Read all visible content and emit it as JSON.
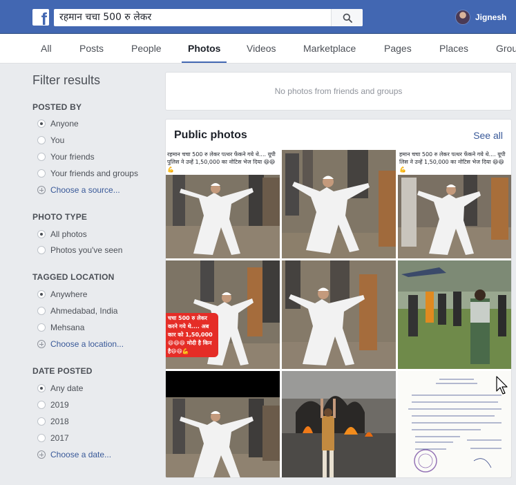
{
  "header": {
    "search_value": "रहमान चचा 500 रु लेकर",
    "user_name": "Jignesh",
    "brand_color": "#4267b2"
  },
  "tabs": [
    {
      "label": "All"
    },
    {
      "label": "Posts"
    },
    {
      "label": "People"
    },
    {
      "label": "Photos",
      "active": true
    },
    {
      "label": "Videos"
    },
    {
      "label": "Marketplace"
    },
    {
      "label": "Pages"
    },
    {
      "label": "Places"
    },
    {
      "label": "Grou"
    }
  ],
  "filters": {
    "title": "Filter results",
    "posted_by": {
      "heading": "POSTED BY",
      "options": [
        "Anyone",
        "You",
        "Your friends",
        "Your friends and groups"
      ],
      "selected": "Anyone",
      "choose": "Choose a source..."
    },
    "photo_type": {
      "heading": "PHOTO TYPE",
      "options": [
        "All photos",
        "Photos you've seen"
      ],
      "selected": "All photos"
    },
    "tagged_location": {
      "heading": "TAGGED LOCATION",
      "options": [
        "Anywhere",
        "Ahmedabad, India",
        "Mehsana"
      ],
      "selected": "Anywhere",
      "choose": "Choose a location..."
    },
    "date_posted": {
      "heading": "DATE POSTED",
      "options": [
        "Any date",
        "2019",
        "2018",
        "2017"
      ],
      "selected": "Any date",
      "choose": "Choose a date..."
    }
  },
  "results": {
    "no_friends_text": "No photos from friends and groups",
    "public_title": "Public photos",
    "see_all": "See all",
    "photos": [
      {
        "caption": "रहमान चचा 500 रु लेकर पत्थर फेंकने गये थे.... यूपी पुलिस ने उन्हें 1,50,000 का नोटिस भेज दिया 😆😆💪"
      },
      {
        "caption": ""
      },
      {
        "caption": "हमान चचा 500 रु लेकर पत्थर फेंकने गये थे.... यूपी लिस ने उन्हें 1,50,000 का नोटिस भेज दिया 😆😆💪"
      },
      {
        "caption": ""
      },
      {
        "caption": "चचा 500 रु लेकर करने गये थे.... अब कार को 1,50,000 😆😆😆 मोदी है किन है😆😆💪"
      },
      {
        "caption": ""
      },
      {
        "caption": ""
      },
      {
        "caption": ""
      },
      {
        "caption": ""
      }
    ]
  }
}
